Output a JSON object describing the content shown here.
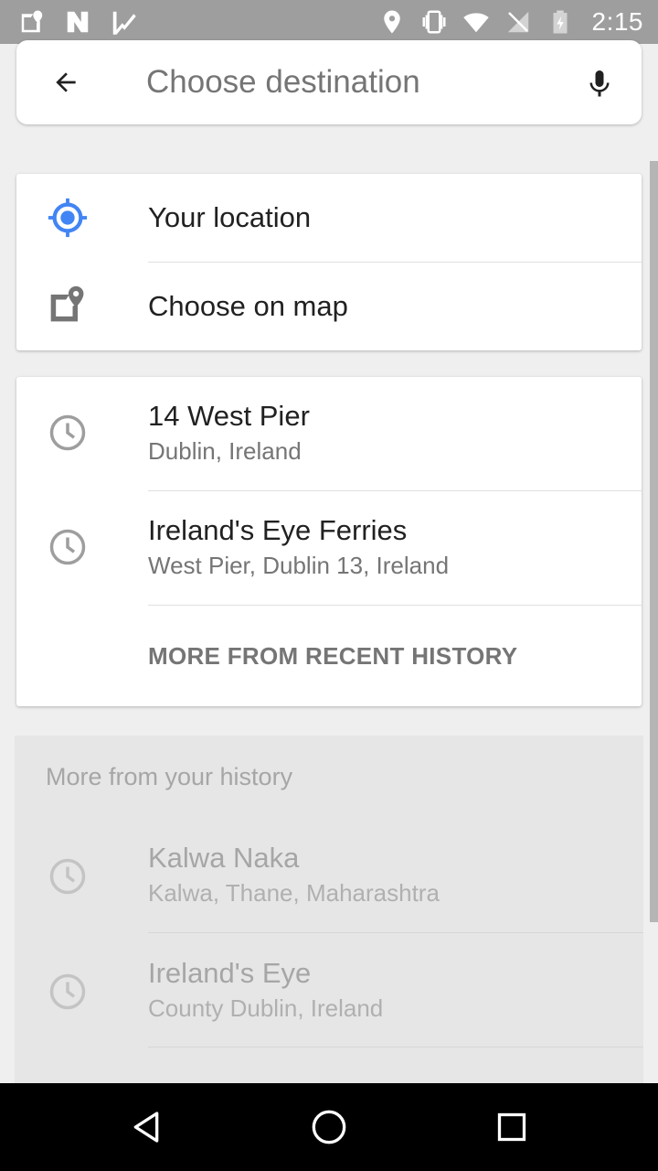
{
  "status_bar": {
    "time": "2:15",
    "left_icons": [
      "google-maps-notification-icon",
      "n-notification-icon",
      "check-flag-notification-icon"
    ],
    "right_icons": [
      "location-icon",
      "vibrate-icon",
      "wifi-icon",
      "no-signal-icon",
      "battery-charging-icon"
    ]
  },
  "search": {
    "placeholder": "Choose destination",
    "value": ""
  },
  "quick_options": [
    {
      "label": "Your location",
      "icon": "my-location-icon"
    },
    {
      "label": "Choose on map",
      "icon": "map-pin-icon"
    }
  ],
  "recent": {
    "items": [
      {
        "title": "14 West Pier",
        "subtitle": "Dublin, Ireland",
        "icon": "clock-icon"
      },
      {
        "title": "Ireland's Eye Ferries",
        "subtitle": "West Pier, Dublin 13, Ireland",
        "icon": "clock-icon"
      }
    ],
    "more_label": "MORE FROM RECENT HISTORY"
  },
  "history": {
    "heading": "More from your history",
    "items": [
      {
        "title": "Kalwa Naka",
        "subtitle": "Kalwa, Thane, Maharashtra",
        "icon": "clock-icon"
      },
      {
        "title": "Ireland's Eye",
        "subtitle": "County Dublin, Ireland",
        "icon": "clock-icon"
      }
    ]
  },
  "nav": {
    "buttons": [
      "back-nav-icon",
      "home-nav-icon",
      "recents-nav-icon"
    ]
  },
  "colors": {
    "accent_blue": "#4285f4",
    "status_bar": "#9e9e9e",
    "secondary_text": "#757575"
  }
}
